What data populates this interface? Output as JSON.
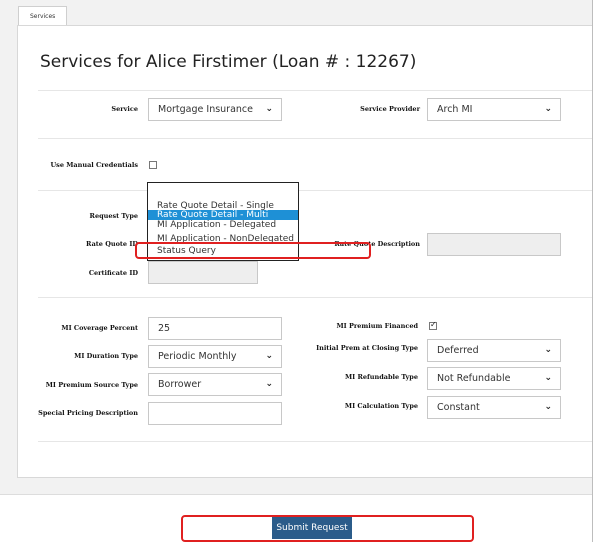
{
  "tabs": [
    "Services"
  ],
  "title": "Services for Alice Firstimer (Loan # : 12267)",
  "service": {
    "label": "Service",
    "value": "Mortgage Insurance"
  },
  "service_provider": {
    "label": "Service Provider",
    "value": "Arch MI"
  },
  "manual_credentials": {
    "label": "Use Manual Credentials",
    "checked": false
  },
  "request_type": {
    "label": "Request Type"
  },
  "request_type_options": [
    "Rate Quote Detail - Single",
    "Rate Quote Detail - Multi",
    "MI Application - Delegated",
    "MI Application - NonDelegated",
    "Status Query"
  ],
  "request_type_highlighted": "Rate Quote Detail - Multi",
  "rate_quote_id": {
    "label": "Rate Quote ID",
    "value": ""
  },
  "rate_quote_description": {
    "label": "Rate Quote Description",
    "value": ""
  },
  "certificate_id": {
    "label": "Certificate ID",
    "value": ""
  },
  "mi_coverage_percent": {
    "label": "MI Coverage Percent",
    "value": "25"
  },
  "mi_premium_financed": {
    "label": "MI Premium Financed",
    "checked": true
  },
  "mi_duration_type": {
    "label": "MI Duration Type",
    "value": "Periodic Monthly"
  },
  "initial_prem_closing_type": {
    "label": "Initial Prem at Closing Type",
    "value": "Deferred"
  },
  "mi_premium_source_type": {
    "label": "MI Premium Source Type",
    "value": "Borrower"
  },
  "mi_refundable_type": {
    "label": "MI Refundable Type",
    "value": "Not Refundable"
  },
  "special_pricing_description": {
    "label": "Special Pricing Description",
    "value": ""
  },
  "mi_calculation_type": {
    "label": "MI Calculation Type",
    "value": "Constant"
  },
  "submit_label": "Submit Request",
  "colors": {
    "highlight": "#1e90d6",
    "annotation": "#e02020",
    "primary_button": "#2b5c8a"
  }
}
